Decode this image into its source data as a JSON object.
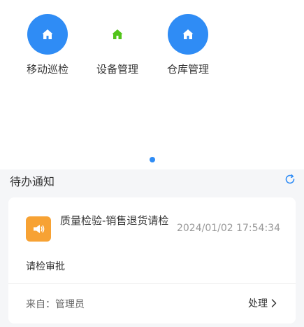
{
  "apps": [
    {
      "label": "移动巡检",
      "icon": "home-icon"
    },
    {
      "label": "设备管理",
      "icon": "home-icon"
    },
    {
      "label": "仓库管理",
      "icon": "home-icon"
    }
  ],
  "pager": {
    "active_page": 1
  },
  "todo": {
    "title": "待办通知",
    "refresh_icon": "refresh-icon",
    "items": [
      {
        "icon": "megaphone-icon",
        "title": "质量检验-销售退货请检",
        "time": "2024/01/02 17:54:34",
        "description": "请检审批",
        "from": "来自：管理员",
        "action": "处理",
        "action_icon": "chevron-right-icon"
      }
    ]
  },
  "colors": {
    "primary": "#2f8cf5",
    "green": "#52c41a",
    "orange": "#f7a234"
  }
}
